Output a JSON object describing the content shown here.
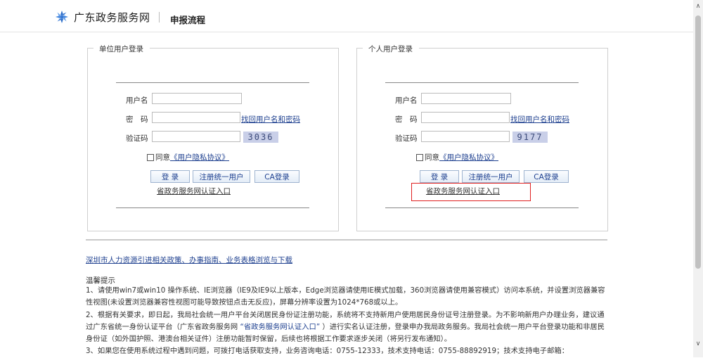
{
  "header": {
    "site_title": "广东政务服务网",
    "page_title": "申报流程"
  },
  "unit_login": {
    "legend": "单位用户登录",
    "username_label": "用户名",
    "password_label": "密　码",
    "captcha_label": "验证码",
    "forgot_link": "找回用户名和密码",
    "captcha_text": "3036",
    "agree_prefix": "同意",
    "agree_link": "《用户隐私协议》",
    "login_button": "登 录",
    "register_button": "注册统一用户",
    "ca_button": "CA登录",
    "gov_link": "省政务服务网认证入口"
  },
  "personal_login": {
    "legend": "个人用户登录",
    "username_label": "用户名",
    "password_label": "密　码",
    "captcha_label": "验证码",
    "forgot_link": "找回用户名和密码",
    "captcha_text": "9177",
    "agree_prefix": "同意",
    "agree_link": "《用户隐私协议》",
    "login_button": "登 录",
    "register_button": "注册统一用户",
    "ca_button": "CA登录",
    "gov_link": "省政务服务网认证入口"
  },
  "policy_link": "深圳市人力资源引进相关政策、办事指南、业务表格浏览与下载",
  "tips": {
    "title": "温馨提示",
    "item1": "1、请使用win7或win10 操作系统、IE浏览器（IE9及IE9以上版本，Edge浏览器请使用IE模式加载，360浏览器请使用兼容模式）访问本系统，并设置浏览器兼容性视图(未设置浏览器兼容性视图可能导致按钮点击无反应)，屏幕分辨率设置为1024*768或以上。",
    "item2_a": "2、根据有关要求，即日起，我局社会统一用户平台关闭居民身份证注册功能，系统将不支持新用户使用居民身份证号注册登录。为不影响新用户办理业务，建议通过广东省统一身份认证平台（广东省政务服务网 ",
    "item2_link": "“省政务服务网认证入口”",
    "item2_b": " ）进行实名认证注册，登录申办我局政务服务。我局社会统一用户平台登录功能和非居民身份证（如外国护照、港澳台相关证件）注册功能暂时保留，后续也将根据工作要求逐步关闭（将另行发布通知）。",
    "item3": "3、如果您在使用系统过程中遇到问题，可拨打电话获取支持，业务咨询电话：0755-12333，技术支持电话：0755-88892919；技术支持电子邮箱："
  }
}
